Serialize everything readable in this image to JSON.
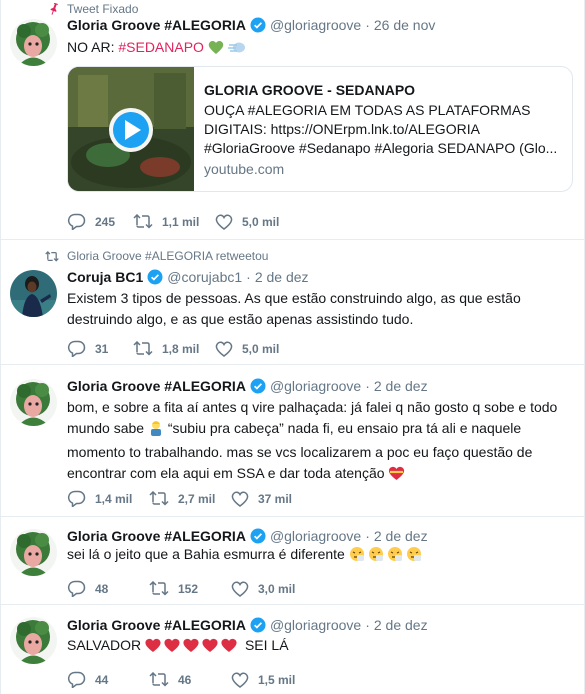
{
  "tweets": [
    {
      "context": "Tweet Fixado",
      "name": "Gloria Groove #ALEGORIA",
      "handle": "@gloriagroove",
      "time": "26 de nov",
      "text_prefix": "NO AR: ",
      "hashtag": "#SEDANAPO",
      "card": {
        "title": "GLORIA GROOVE - SEDANAPO",
        "description": "OUÇA #ALEGORIA EM TODAS AS PLATAFORMAS DIGITAIS: https://ONErpm.lnk.to/ALEGORIA #GloriaGroove #Sedanapo #Alegoria SEDANAPO (Glo...",
        "domain": "youtube.com"
      },
      "replies": "245",
      "retweets": "1,1 mil",
      "likes": "5,0 mil"
    },
    {
      "context": "Gloria Groove #ALEGORIA retweetou",
      "name": "Coruja BC1",
      "handle": "@corujabc1",
      "time": "2 de dez",
      "text": "Existem 3 tipos de pessoas. As que estão construindo algo, as que estão destruindo algo, e as que estão apenas assistindo tudo.",
      "replies": "31",
      "retweets": "1,8 mil",
      "likes": "5,0 mil"
    },
    {
      "name": "Gloria Groove #ALEGORIA",
      "handle": "@gloriagroove",
      "time": "2 de dez",
      "text_a": "bom, e sobre a fita aí antes q vire palhaçada: já falei q não gosto q sobe e todo mundo sabe ",
      "text_b": " “subiu pra cabeça” nada fi, eu ensaio pra tá ali e naquele momento to trabalhando. mas se vcs localizarem a poc eu faço questão de encontrar com ela aqui em SSA e dar toda atenção ",
      "replies": "1,4 mil",
      "retweets": "2,7 mil",
      "likes": "37 mil"
    },
    {
      "name": "Gloria Groove #ALEGORIA",
      "handle": "@gloriagroove",
      "time": "2 de dez",
      "text": "sei lá o jeito que a Bahia esmurra é diferente ",
      "replies": "48",
      "retweets": "152",
      "likes": "3,0 mil"
    },
    {
      "name": "Gloria Groove #ALEGORIA",
      "handle": "@gloriagroove",
      "time": "2 de dez",
      "text_a": "SALVADOR ",
      "text_b": " SEI LÁ",
      "replies": "44",
      "retweets": "46",
      "likes": "1,5 mil"
    }
  ],
  "icons": {
    "pin": "pin-icon",
    "retweet": "retweet-icon",
    "reply": "reply-icon",
    "like": "heart-icon",
    "verified": "verified-badge-icon",
    "play": "play-icon"
  },
  "colors": {
    "accent_blue": "#1da1f2",
    "hashtag": "#e0245e",
    "muted": "#657786",
    "pin": "#e0245e"
  }
}
